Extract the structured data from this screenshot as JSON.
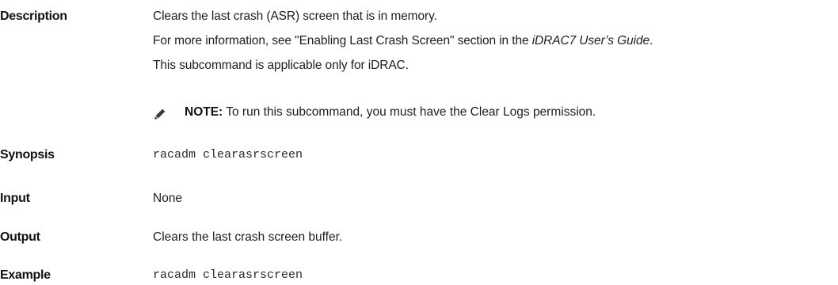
{
  "description": {
    "label": "Description",
    "line1": "Clears the last crash (ASR) screen that is in memory.",
    "line2_pre": "For more information, see \"Enabling Last Crash Screen\" section in the ",
    "line2_italic": "iDRAC7 User’s Guide",
    "line2_post": ".",
    "line3": "This subcommand is applicable only for iDRAC.",
    "note": {
      "icon": "pencil-note-icon",
      "label": "NOTE:",
      "text": " To run this subcommand, you must have the Clear Logs permission."
    }
  },
  "synopsis": {
    "label": "Synopsis",
    "value": "racadm clearasrscreen"
  },
  "input": {
    "label": "Input",
    "value": "None"
  },
  "output": {
    "label": "Output",
    "value": "Clears the last crash screen buffer."
  },
  "example": {
    "label": "Example",
    "value": "racadm clearasrscreen"
  }
}
